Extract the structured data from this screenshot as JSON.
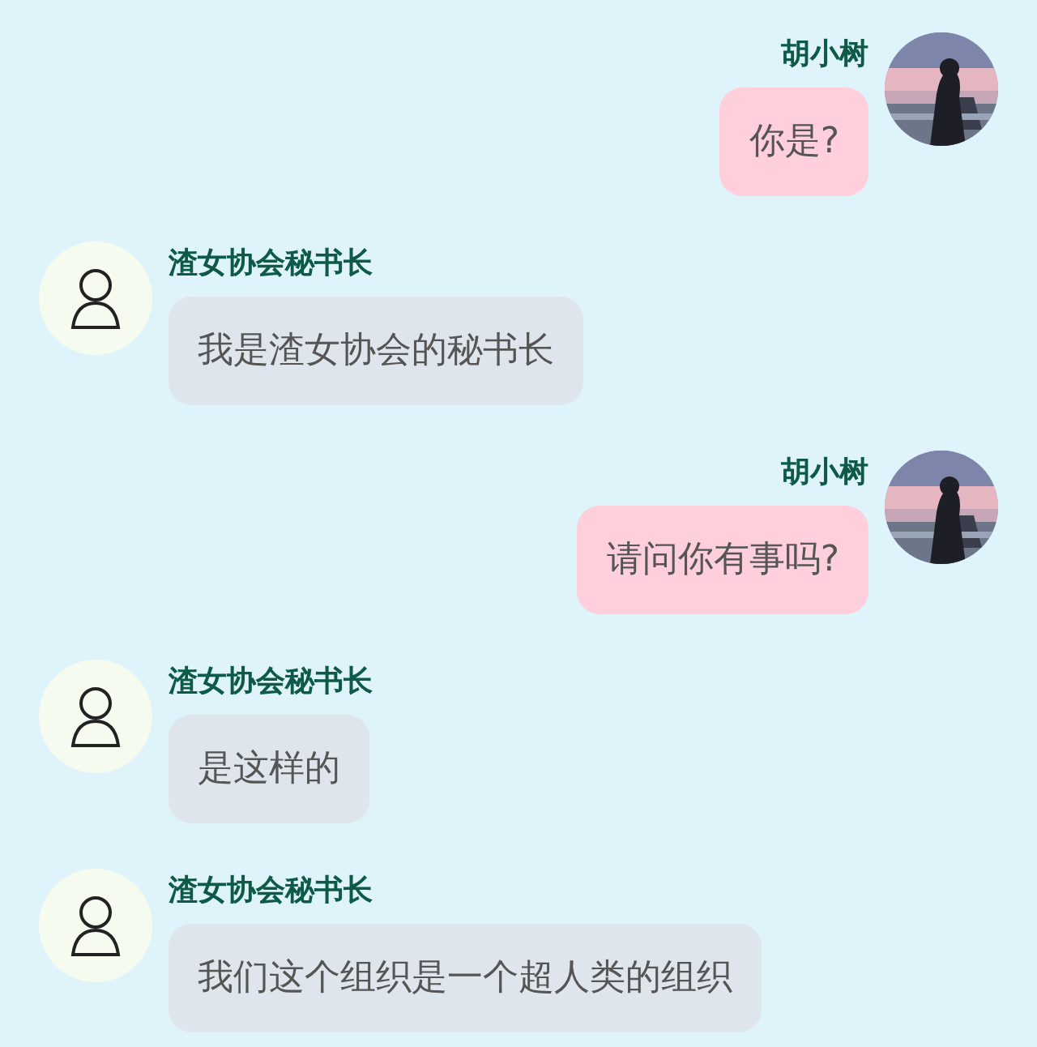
{
  "messages": [
    {
      "kind": "sent",
      "sender": "胡小树",
      "text": "你是?"
    },
    {
      "kind": "received",
      "sender": "渣女协会秘书长",
      "text": "我是渣女协会的秘书长"
    },
    {
      "kind": "sent",
      "sender": "胡小树",
      "text": "请问你有事吗?"
    },
    {
      "kind": "received",
      "sender": "渣女协会秘书长",
      "text": "是这样的"
    },
    {
      "kind": "received",
      "sender": "渣女协会秘书长",
      "text": "我们这个组织是一个超人类的组织"
    }
  ]
}
